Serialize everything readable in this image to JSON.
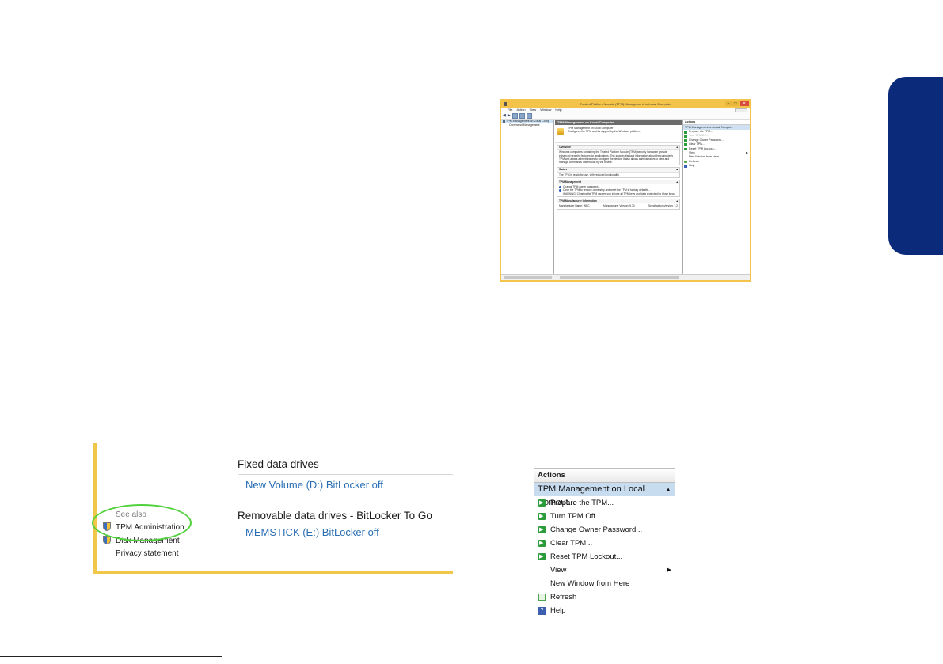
{
  "tpm_window": {
    "title": "Trusted Platform Module (TPM) Management on Local Computer",
    "menu": [
      "File",
      "Action",
      "View",
      "Window",
      "Help"
    ],
    "tree": [
      {
        "label": "TPM Management on Local Comp",
        "selected": true
      },
      {
        "label": "Command Management",
        "selected": false
      }
    ],
    "center": {
      "header": "TPM Management on Local Computer",
      "intro_title": "TPM Management on Local Computer",
      "intro_desc": "Configures the TPM and its support by the Windows platform",
      "overview": {
        "title": "Overview",
        "text": "Windows computers containing the Trusted Platform Module (TPM) security hardware provide enhanced security features for applications. This snap-in displays information about the computer's TPM and allows administrators to configure the device. It also allows administrators to view and manage commands understood by the device."
      },
      "status": {
        "title": "Status",
        "text": "The TPM is ready for use, with reduced functionality."
      },
      "management": {
        "title": "TPM Management",
        "items": [
          "Change TPM owner password...",
          "Clear the TPM to remove ownership and reset the TPM to factory defaults..."
        ],
        "warning": "WARNING: Clearing the TPM causes you to lose all TPM keys and data protected by those keys."
      },
      "manufacturer": {
        "title": "TPM Manufacturer Information",
        "name": "Manufacturer Name:  WEC",
        "version": "Manufacturer Version:  5.70",
        "spec": "Specification Version:  1.2"
      }
    },
    "actions": {
      "header": "Actions",
      "sub": "TPM Management on Local Comput...",
      "items": [
        "Prepare the TPM...",
        "Turn TPM Off...",
        "Change Owner Password...",
        "Clear TPM...",
        "Reset TPM Lockout...",
        "View",
        "New Window from Here",
        "Refresh",
        "Help"
      ]
    }
  },
  "bitlocker": {
    "fixed_title": "Fixed data drives",
    "fixed_link": "New Volume (D:) BitLocker off",
    "removable_title": "Removable data drives - BitLocker To Go",
    "removable_link": "MEMSTICK (E:) BitLocker off",
    "see_also": "See also",
    "side_links": [
      "TPM Administration",
      "Disk Management",
      "Privacy statement"
    ]
  },
  "actions_zoom": {
    "header": "Actions",
    "sub": "TPM Management on Local Comput...",
    "items": [
      "Prepare the TPM...",
      "Turn TPM Off...",
      "Change Owner Password...",
      "Clear TPM...",
      "Reset TPM Lockout...",
      "View",
      "New Window from Here",
      "Refresh",
      "Help"
    ]
  },
  "colors": {
    "side_tab": "#0b2b7a",
    "window_frame": "#f4c44a",
    "highlight_ellipse": "#4fd13a",
    "link_blue": "#2a6fb5"
  }
}
